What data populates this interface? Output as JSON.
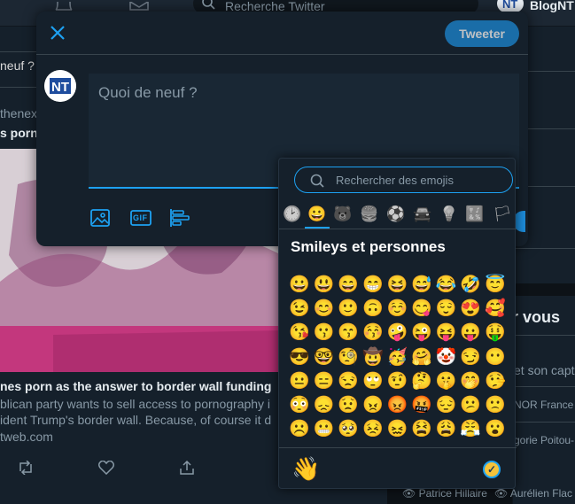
{
  "topbar": {
    "search_placeholder": "Recherche Twitter",
    "account_name": "BlogNT"
  },
  "feed": {
    "lines": [
      "neuf ?",
      "thenex",
      "s porn",
      "nes porn as the answer to border wall funding",
      "blican party wants to sell access to pornography i",
      "ident Trump's border wall. Because, of course it d",
      "tweb.com"
    ]
  },
  "right_column": {
    "heading": "r vous",
    "items": [
      "et son capt",
      "NOR France",
      "gorie Poitou-"
    ]
  },
  "bottom_users": [
    "Patrice Hillaire",
    "Aurélien Flac"
  ],
  "compose": {
    "tweet_button": "Tweeter",
    "placeholder": "Quoi de neuf ?",
    "avatar_text": "NT",
    "gif_label": "GIF"
  },
  "emoji_picker": {
    "search_placeholder": "Rechercher des emojis",
    "category_title": "Smileys et personnes",
    "categories": [
      {
        "name": "recent-icon",
        "glyph": "🕑"
      },
      {
        "name": "smileys-icon",
        "glyph": "😀"
      },
      {
        "name": "animals-icon",
        "glyph": "🐻"
      },
      {
        "name": "food-icon",
        "glyph": "🍔"
      },
      {
        "name": "activity-icon",
        "glyph": "⚽"
      },
      {
        "name": "travel-icon",
        "glyph": "🚘"
      },
      {
        "name": "objects-icon",
        "glyph": "💡"
      },
      {
        "name": "symbols-icon",
        "glyph": "🔣"
      },
      {
        "name": "flags-icon",
        "glyph": "🏳"
      }
    ],
    "emojis": [
      "😀",
      "😃",
      "😄",
      "😁",
      "😆",
      "😅",
      "😂",
      "🤣",
      "😇",
      "😉",
      "😊",
      "🙂",
      "🙃",
      "☺️",
      "😋",
      "😌",
      "😍",
      "🥰",
      "😘",
      "😗",
      "😙",
      "😚",
      "🤪",
      "😜",
      "😝",
      "😛",
      "🤑",
      "😎",
      "🤓",
      "🧐",
      "🤠",
      "🥳",
      "🤗",
      "🤡",
      "😏",
      "😶",
      "😐",
      "😑",
      "😒",
      "🙄",
      "🤨",
      "🤔",
      "🤫",
      "🤭",
      "🤥",
      "😳",
      "😞",
      "😟",
      "😠",
      "😡",
      "🤬",
      "😔",
      "😕",
      "🙁",
      "☹️",
      "😬",
      "🥺",
      "😣",
      "😖",
      "😫",
      "😩",
      "😤",
      "😮"
    ],
    "footer_emoji": "👋"
  },
  "colors": {
    "accent": "#1da1f2",
    "tweet_button": "#1d8bd8",
    "background": "#15202b"
  }
}
